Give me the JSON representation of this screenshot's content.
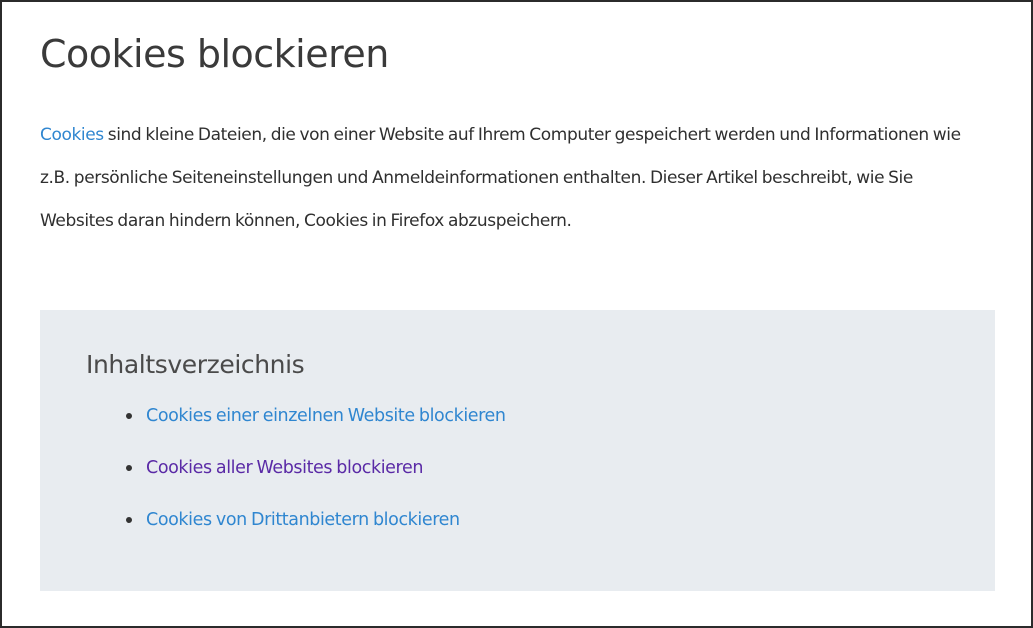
{
  "article": {
    "title": "Cookies blockieren",
    "intro_link": "Cookies",
    "intro_text": " sind kleine Dateien, die von einer Website auf Ihrem Computer gespeichert werden und Informationen wie z.B. persönliche Seiteneinstellungen und Anmeldeinformationen enthalten. Dieser Artikel beschreibt, wie Sie Websites daran hindern können, Cookies in Firefox abzuspeichern."
  },
  "toc": {
    "heading": "Inhaltsverzeichnis",
    "items": [
      {
        "label": "Cookies einer einzelnen Website blockieren",
        "visited": false
      },
      {
        "label": "Cookies aller Websites blockieren",
        "visited": true
      },
      {
        "label": "Cookies von Drittanbietern blockieren",
        "visited": false
      }
    ]
  },
  "colors": {
    "link": "#2f86d0",
    "visited_link": "#5a2aa6",
    "toc_background": "#e8ecf0",
    "text": "#2f2f2f"
  }
}
